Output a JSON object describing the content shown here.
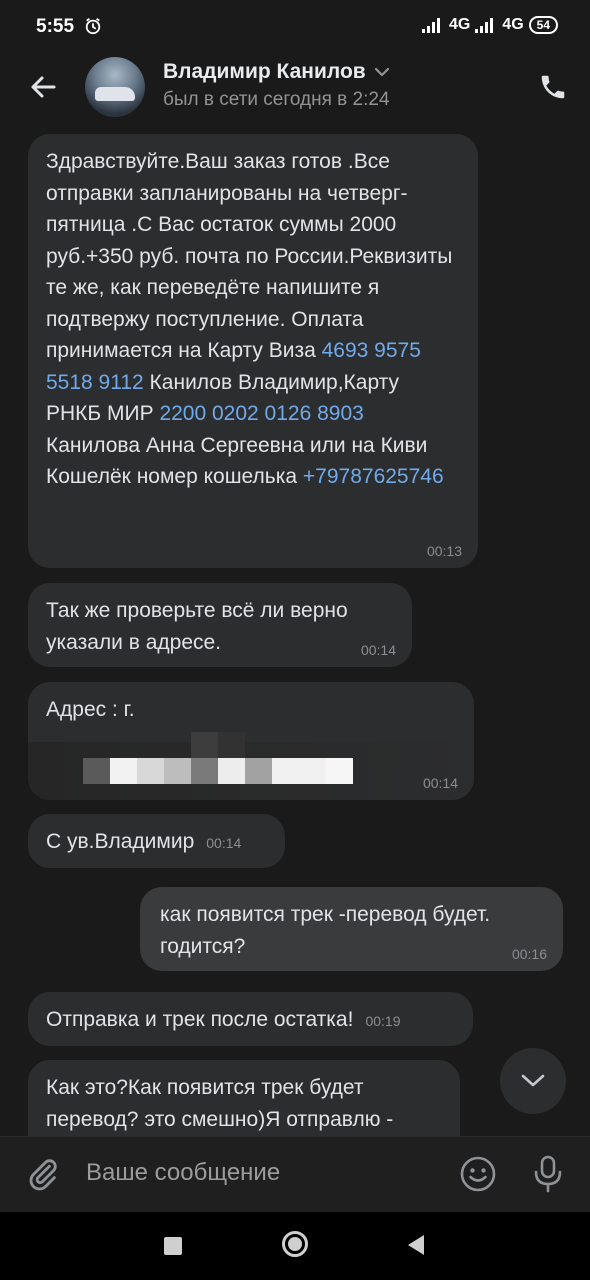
{
  "statusbar": {
    "time": "5:55",
    "net1": "4G",
    "net2": "4G",
    "battery": "54"
  },
  "header": {
    "contact_name": "Владимир Канилов",
    "last_seen": "был в сети сегодня в 2:24"
  },
  "messages": [
    {
      "dir": "in",
      "parts": [
        "Здравствуйте.Ваш заказ готов .Все отправки запланированы на четверг-пятница .С Вас остаток суммы 2000 руб.+350 руб. почта по России.Реквизиты те же, как переведёте напишите я подтвержу поступление. Оплата принимается на Карту Виза ",
        "4693 9575 5518 9112",
        " Канилов Владимир,Карту РНКБ МИР ",
        "2200 0202 0126 8903",
        " Канилова Анна Сергеевна или на Киви Кошелёк номер кошелька ",
        "+79787625746"
      ],
      "time": "00:13"
    },
    {
      "dir": "in",
      "text": "Так же проверьте всё ли верно указали в адресе.",
      "time": "00:14"
    },
    {
      "dir": "in",
      "text": "Адрес : г.",
      "time": "00:14"
    },
    {
      "dir": "in",
      "text": "С ув.Владимир",
      "time": "00:14"
    },
    {
      "dir": "out",
      "text": "как появится трек -перевод будет. годится?",
      "time": "00:16"
    },
    {
      "dir": "in",
      "text": "Отправка и трек после остатка!",
      "time": "00:19"
    },
    {
      "dir": "in",
      "text": "Как это?Как появится трек будет перевод? это смешно)Я отправлю -"
    }
  ],
  "input": {
    "placeholder": "Ваше сообщение"
  },
  "colors": {
    "background": "#1a1a1a",
    "bubble_in": "#2c2d2e",
    "bubble_out": "#3a3b3c",
    "link": "#71aaeb"
  }
}
